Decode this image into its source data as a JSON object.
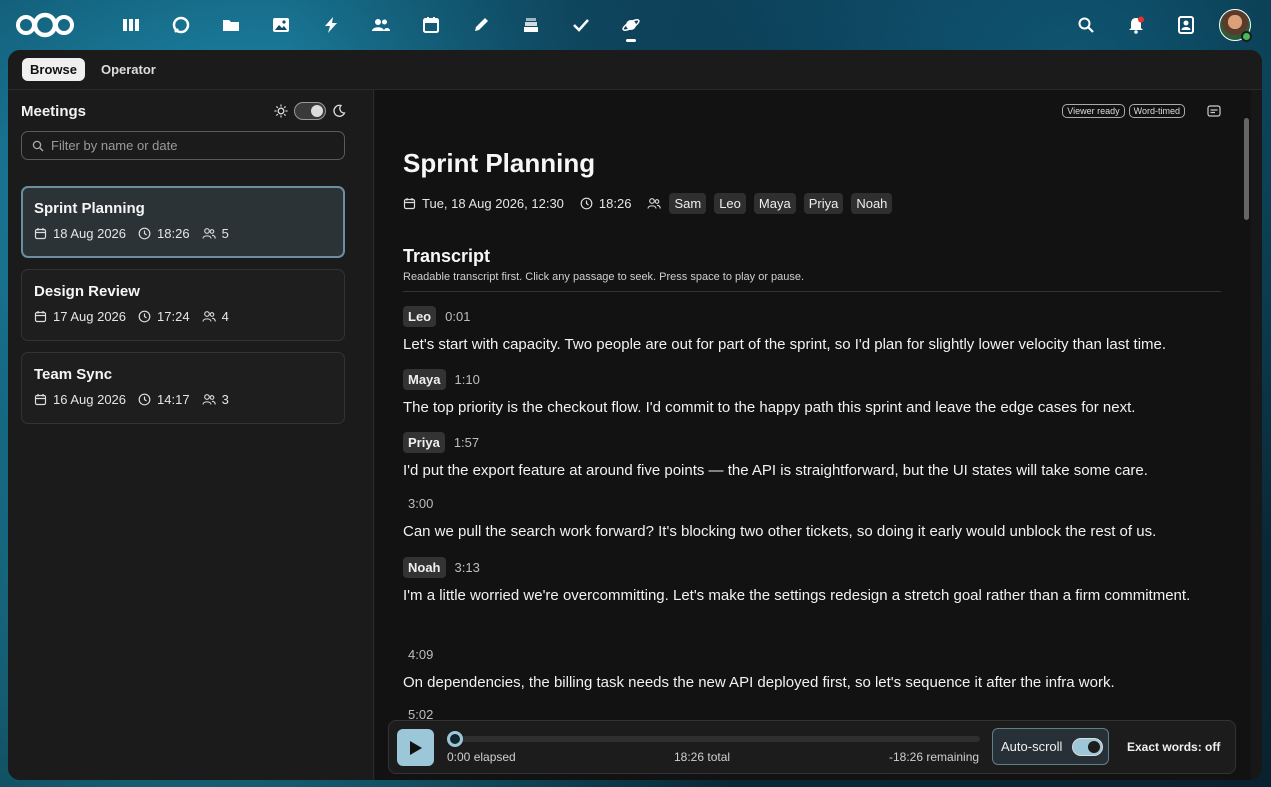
{
  "topbar": {
    "apps": [
      "dashboard-icon",
      "talk-icon",
      "files-icon",
      "photos-icon",
      "activity-icon",
      "contacts-icon",
      "calendar-icon",
      "notes-icon",
      "deck-icon",
      "tasks-icon",
      "meetings-icon"
    ],
    "active_app": "meetings-icon"
  },
  "tabs": [
    {
      "label": "Browse",
      "active": true
    },
    {
      "label": "Operator",
      "active": false
    }
  ],
  "sidebar": {
    "title": "Meetings",
    "filter_placeholder": "Filter by name or date",
    "meetings": [
      {
        "title": "Sprint Planning",
        "date": "18 Aug 2026",
        "duration": "18:26",
        "participants": "5",
        "active": true
      },
      {
        "title": "Design Review",
        "date": "17 Aug 2026",
        "duration": "17:24",
        "participants": "4",
        "active": false
      },
      {
        "title": "Team Sync",
        "date": "16 Aug 2026",
        "duration": "14:17",
        "participants": "3",
        "active": false
      }
    ]
  },
  "content": {
    "badges": [
      "Viewer ready",
      "Word-timed"
    ],
    "title": "Sprint Planning",
    "datetime": "Tue, 18 Aug 2026, 12:30",
    "duration": "18:26",
    "participants": [
      "Sam",
      "Leo",
      "Maya",
      "Priya",
      "Noah"
    ],
    "transcript_title": "Transcript",
    "transcript_subtitle": "Readable transcript first. Click any passage to seek. Press space to play or pause.",
    "segments": [
      {
        "speaker": "Leo",
        "time": "0:01",
        "text": "Let's start with capacity. Two people are out for part of the sprint, so I'd plan for slightly lower velocity than last time."
      },
      {
        "speaker": "Maya",
        "time": "1:10",
        "text": "The top priority is the checkout flow. I'd commit to the happy path this sprint and leave the edge cases for next."
      },
      {
        "speaker": "Priya",
        "time": "1:57",
        "text": "I'd put the export feature at around five points — the API is straightforward, but the UI states will take some care."
      },
      {
        "speaker": "",
        "time": "3:00",
        "text": "Can we pull the search work forward? It's blocking two other tickets, so doing it early would unblock the rest of us."
      },
      {
        "speaker": "Noah",
        "time": "3:13",
        "text": "I'm a little worried we're overcommitting. Let's make the settings redesign a stretch goal rather than a firm commitment."
      },
      {
        "speaker": "",
        "time": "4:09",
        "text": "On dependencies, the billing task needs the new API deployed first, so let's sequence it after the infra work."
      },
      {
        "speaker": "",
        "time": "5:02",
        "text": ""
      }
    ]
  },
  "player": {
    "elapsed": "0:00 elapsed",
    "total": "18:26 total",
    "remaining": "-18:26 remaining",
    "progress": 0,
    "autoscroll_label": "Auto-scroll",
    "autoscroll_on": true,
    "exact_words": "Exact words: off"
  },
  "colors": {
    "accent": "#9cc7d8",
    "window_bg": "#171717",
    "content_bg": "#121212"
  }
}
